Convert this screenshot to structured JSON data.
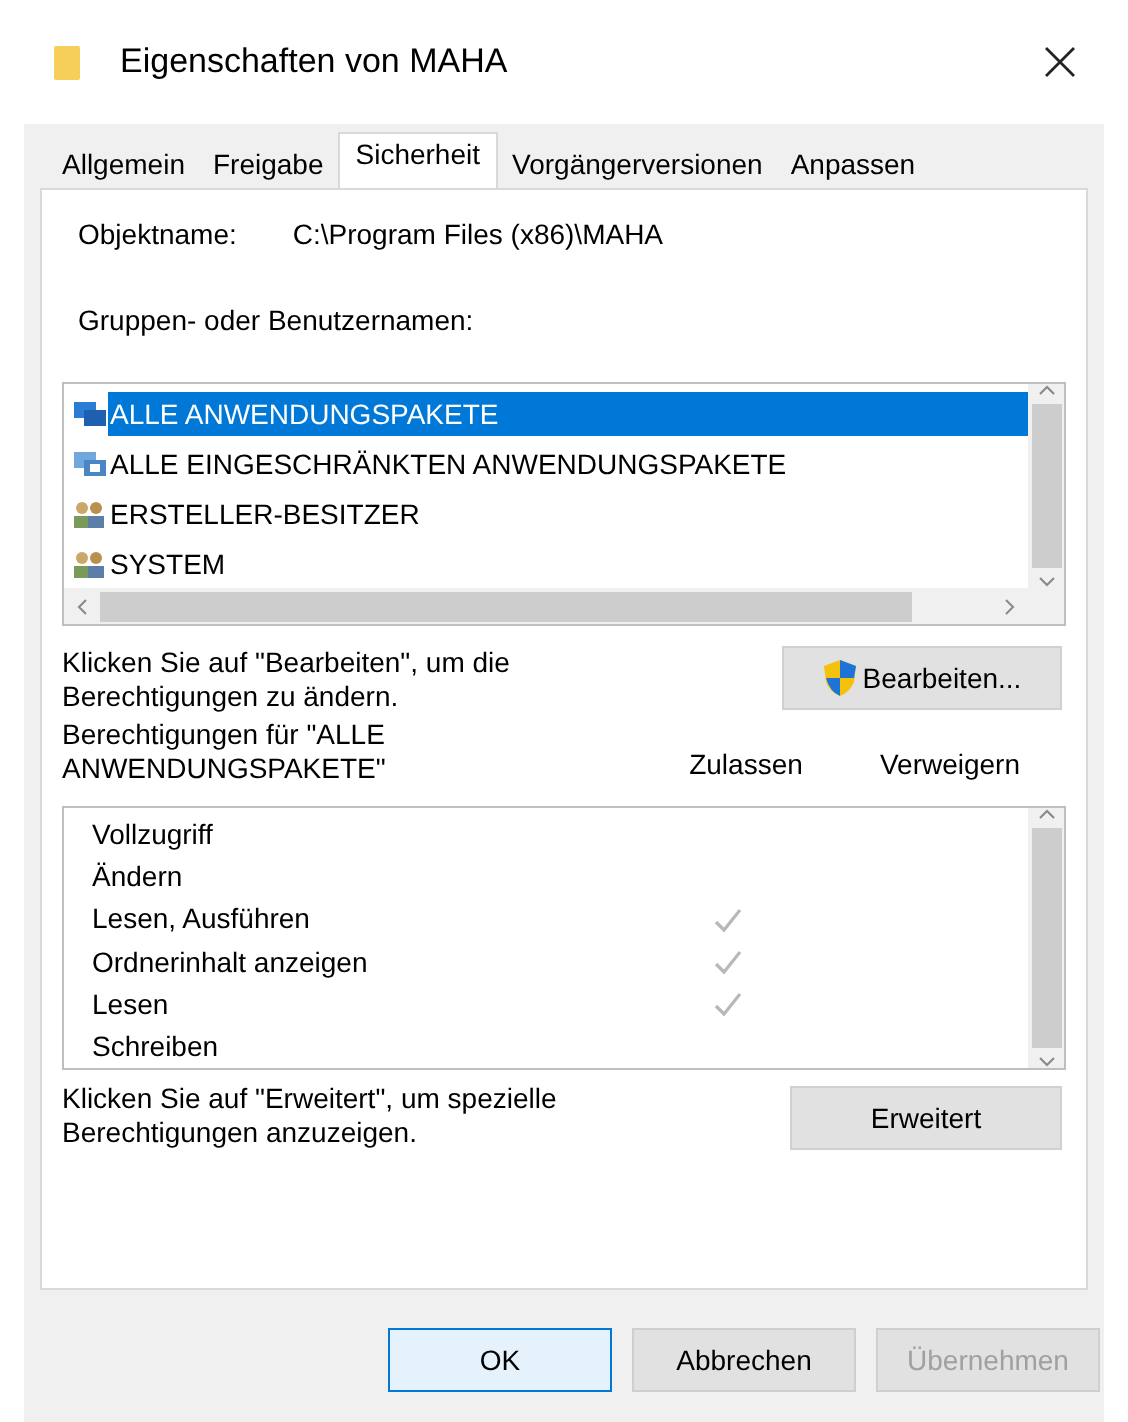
{
  "window": {
    "title": "Eigenschaften von MAHA"
  },
  "tabs": [
    {
      "label": "Allgemein",
      "selected": false
    },
    {
      "label": "Freigabe",
      "selected": false
    },
    {
      "label": "Sicherheit",
      "selected": true
    },
    {
      "label": "Vorgängerversionen",
      "selected": false
    },
    {
      "label": "Anpassen",
      "selected": false
    }
  ],
  "object": {
    "label": "Objektname:",
    "value": "C:\\Program Files (x86)\\MAHA"
  },
  "groups": {
    "label": "Gruppen- oder Benutzernamen:",
    "items": [
      {
        "name": "ALLE ANWENDUNGSPAKETE",
        "kind": "package",
        "selected": true
      },
      {
        "name": "ALLE EINGESCHRÄNKTEN ANWENDUNGSPAKETE",
        "kind": "restricted",
        "selected": false
      },
      {
        "name": "ERSTELLER-BESITZER",
        "kind": "users",
        "selected": false
      },
      {
        "name": "SYSTEM",
        "kind": "users",
        "selected": false
      }
    ]
  },
  "edit": {
    "hint": "Klicken Sie auf \"Bearbeiten\", um die Berechtigungen zu ändern.",
    "button": "Bearbeiten..."
  },
  "permissions": {
    "title": "Berechtigungen für \"ALLE ANWENDUNGSPAKETE\"",
    "allow_label": "Zulassen",
    "deny_label": "Verweigern",
    "rows": [
      {
        "name": "Vollzugriff",
        "allow": false,
        "deny": false
      },
      {
        "name": "Ändern",
        "allow": false,
        "deny": false
      },
      {
        "name": "Lesen, Ausführen",
        "allow": true,
        "deny": false
      },
      {
        "name": "Ordnerinhalt anzeigen",
        "allow": true,
        "deny": false
      },
      {
        "name": "Lesen",
        "allow": true,
        "deny": false
      },
      {
        "name": "Schreiben",
        "allow": false,
        "deny": false
      }
    ]
  },
  "advanced": {
    "hint": "Klicken Sie auf \"Erweitert\", um spezielle Berechtigungen anzuzeigen.",
    "button": "Erweitert"
  },
  "buttons": [
    {
      "label": "OK",
      "kind": "default",
      "disabled": false
    },
    {
      "label": "Abbrechen",
      "kind": "normal",
      "disabled": false
    },
    {
      "label": "Übernehmen",
      "kind": "normal",
      "disabled": true
    }
  ]
}
